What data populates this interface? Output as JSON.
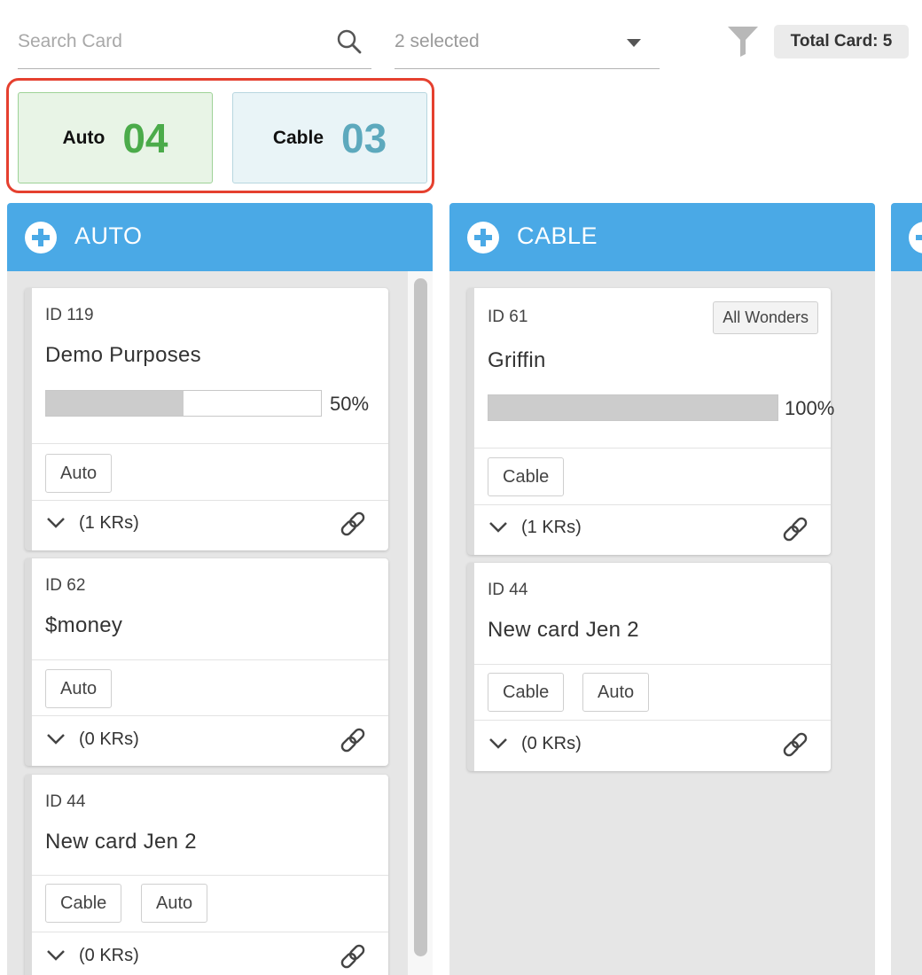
{
  "toolbar": {
    "search_placeholder": "Search Card",
    "selected_label": "2 selected",
    "total_label": "Total Card: 5"
  },
  "summary": [
    {
      "label": "Auto",
      "count": "04",
      "color": "#4bab4a"
    },
    {
      "label": "Cable",
      "count": "03",
      "color": "#5da9bd"
    }
  ],
  "columns": [
    {
      "title": "AUTO",
      "header_color": "#4aa9e6",
      "cards": [
        {
          "id": "ID 119",
          "title": "Demo Purposes",
          "progress": 50,
          "progress_label": "50%",
          "tags": [
            "Auto"
          ],
          "krs": "(1 KRs)"
        },
        {
          "id": "ID 62",
          "title": "$money",
          "tags": [
            "Auto"
          ],
          "krs": "(0 KRs)"
        },
        {
          "id": "ID 44",
          "title": "New card Jen 2",
          "tags": [
            "Cable",
            "Auto"
          ],
          "krs": "(0 KRs)"
        }
      ]
    },
    {
      "title": "CABLE",
      "header_color": "#4aa9e6",
      "cards": [
        {
          "id": "ID 61",
          "title": "Griffin",
          "owner": "All Wonders",
          "progress": 100,
          "progress_label": "100%",
          "tags": [
            "Cable"
          ],
          "krs": "(1 KRs)"
        },
        {
          "id": "ID 44",
          "title": "New card Jen 2",
          "tags": [
            "Cable",
            "Auto"
          ],
          "krs": "(0 KRs)"
        }
      ]
    }
  ],
  "icons": {
    "search": "search-icon",
    "dropdown": "caret-down-icon",
    "filter": "filter-icon",
    "add": "plus-circle-icon",
    "expand": "chevron-down-icon",
    "link": "link-icon"
  }
}
